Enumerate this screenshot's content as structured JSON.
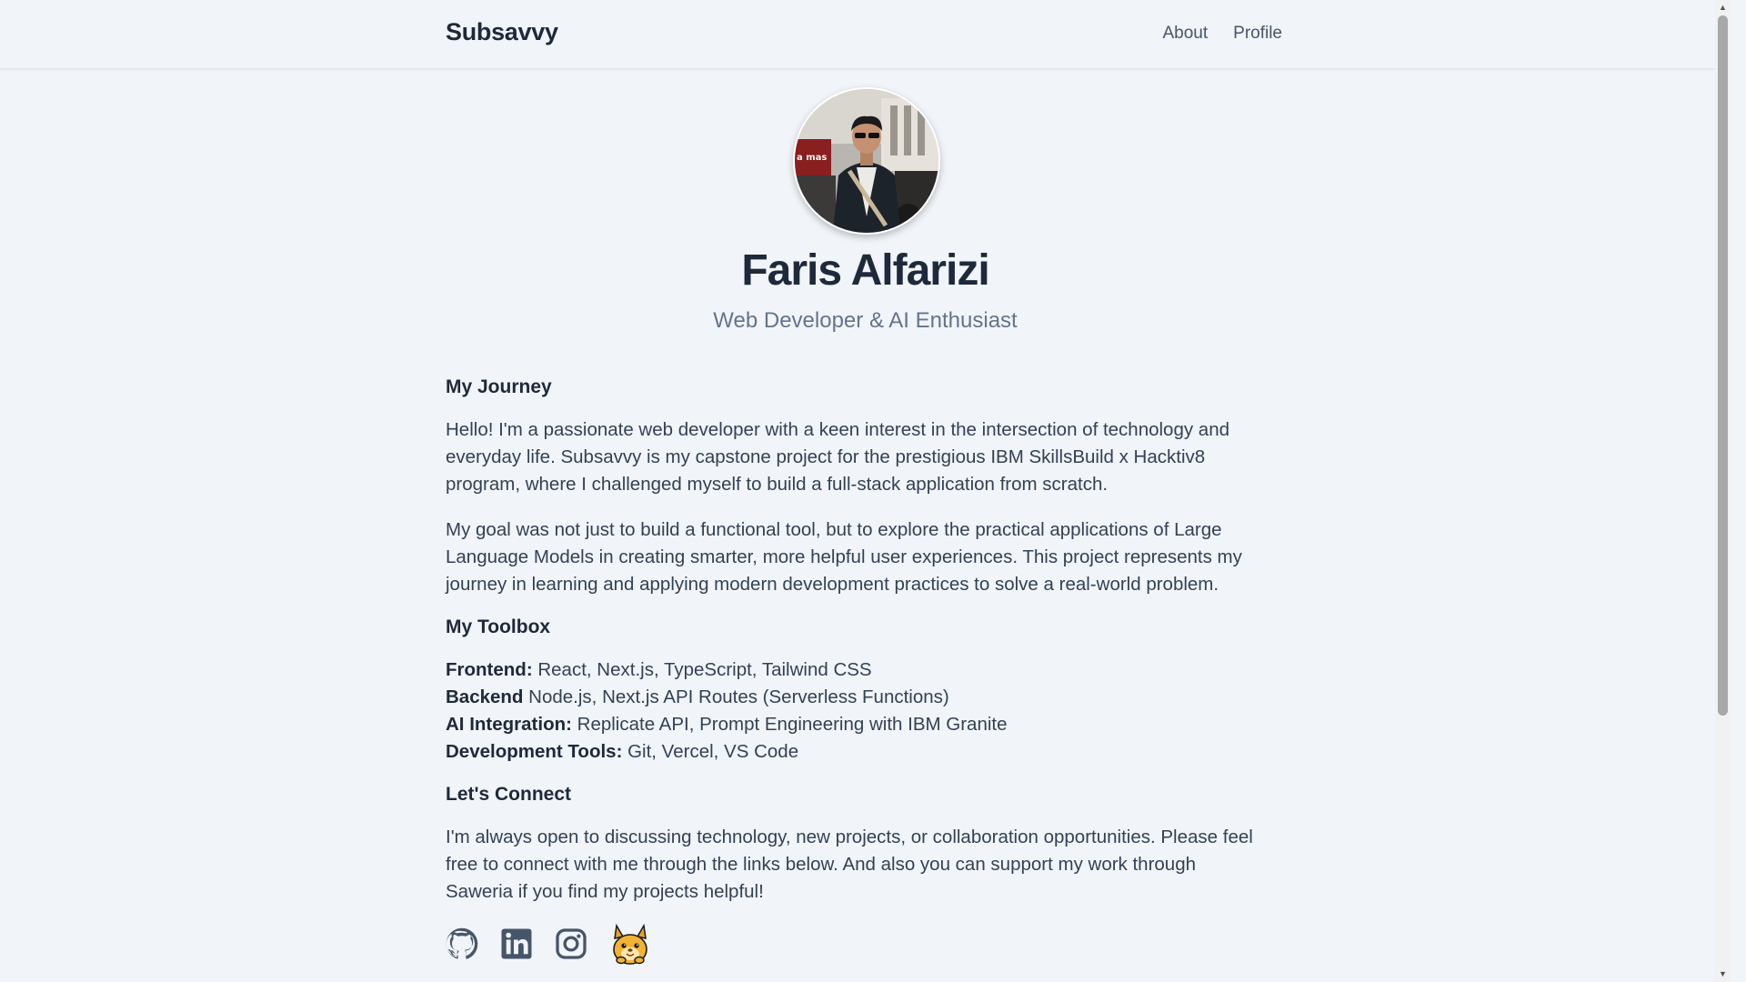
{
  "header": {
    "brand": "Subsavvy",
    "nav": [
      {
        "label": "About"
      },
      {
        "label": "Profile"
      }
    ]
  },
  "profile": {
    "name": "Faris Alfarizi",
    "title": "Web Developer & AI Enthusiast"
  },
  "journey": {
    "heading": "My Journey",
    "paragraphs": [
      "Hello! I'm a passionate web developer with a keen interest in the intersection of technology and everyday life. Subsavvy is my capstone project for the prestigious IBM SkillsBuild x Hacktiv8 program, where I challenged myself to build a full-stack application from scratch.",
      "My goal was not just to build a functional tool, but to explore the practical applications of Large Language Models in creating smarter, more helpful user experiences. This project represents my journey in learning and applying modern development practices to solve a real-world problem."
    ]
  },
  "toolbox": {
    "heading": "My Toolbox",
    "items": [
      {
        "label": "Frontend:",
        "value": " React, Next.js, TypeScript, Tailwind CSS"
      },
      {
        "label": "Backend",
        "value": " Node.js, Next.js API Routes (Serverless Functions)"
      },
      {
        "label": "AI Integration:",
        "value": " Replicate API, Prompt Engineering with IBM Granite"
      },
      {
        "label": "Development Tools:",
        "value": " Git, Vercel, VS Code"
      }
    ]
  },
  "connect": {
    "heading": "Let's Connect",
    "text": "I'm always open to discussing technology, new projects, or collaboration opportunities. Please feel free to connect with me through the links below. And also you can support my work through Saweria if you find my projects helpful!",
    "icons": [
      "github-icon",
      "linkedin-icon",
      "instagram-icon",
      "saweria-icon"
    ]
  },
  "colors": {
    "background": "#f1f5f9",
    "text": "#334155",
    "heading": "#1e293b",
    "muted": "#64748b",
    "icon": "#475569"
  }
}
